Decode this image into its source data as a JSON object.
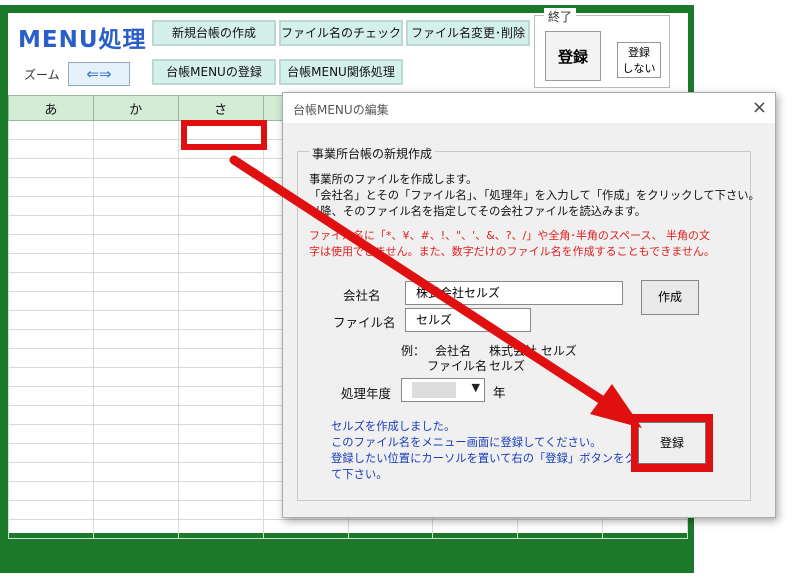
{
  "menu": {
    "title": "MENU処理",
    "zoom_label": "ズーム",
    "zoom_arrows": "⇐⇒",
    "buttons": [
      "新規台帳の作成",
      "ファイル名のチェック",
      "ファイル名変更･削除",
      "台帳MENUの登録",
      "台帳MENU関係処理"
    ],
    "exit_group_label": "終了",
    "register_label": "登録",
    "no_register_line1": "登録",
    "no_register_line2": "しない"
  },
  "sheet": {
    "columns": [
      "あ",
      "か",
      "さ",
      "",
      "",
      "",
      "",
      ""
    ],
    "row_count": 22
  },
  "dialog": {
    "title": "台帳MENUの編集",
    "close": "×",
    "section_title": "事業所台帳の新規作成",
    "desc_lines": [
      "事業所のファイルを作成します。",
      "「会社名」とその「ファイル名」、「処理年」を入力して「作成」をクリックして下さい。",
      "以降、そのファイル名を指定してその会社ファイルを読込みます。"
    ],
    "warning_lines": [
      "ファイル名に「*、¥、#、!、\"、'、&、?、/」や全角･半角のスペース、 半角の文",
      "字は使用できません。また、数字だけのファイル名を作成することもできません。"
    ],
    "company_label": "会社名",
    "company_value": "株式会社セルズ",
    "file_label": "ファイル名",
    "file_value": "セルズ",
    "create_button": "作成",
    "example_prefix": "例：",
    "example_company_label": "会社名",
    "example_company_value": "株式会社 セルズ",
    "example_file_label": "ファイル名",
    "example_file_value": "セルズ",
    "year_label": "処理年度",
    "year_suffix": "年",
    "info_lines": [
      "セルズを作成しました。",
      "このファイル名をメニュー画面に登録してください。",
      "登録したい位置にカーソルを置いて右の「登録」ボタンをクリックし",
      "て下さい。"
    ],
    "register_button": "登録"
  },
  "colors": {
    "frame": "#1a7a2a",
    "title_blue": "#2a5fc8",
    "highlight_red": "#e01010",
    "warning_red": "#e02020",
    "info_blue": "#1a3db8",
    "button_teal": "#d4f0ea",
    "header_green": "#d3ecd5"
  }
}
